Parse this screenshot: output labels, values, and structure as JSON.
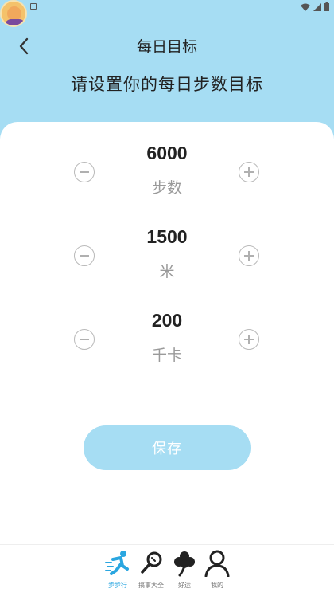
{
  "header": {
    "title": "每日目标",
    "subtitle": "请设置你的每日步数目标"
  },
  "goals": [
    {
      "value": "6000",
      "unit": "步数"
    },
    {
      "value": "1500",
      "unit": "米"
    },
    {
      "value": "200",
      "unit": "千卡"
    }
  ],
  "save_label": "保存",
  "nav": [
    {
      "label": "步步行",
      "icon": "runner-icon",
      "active": true
    },
    {
      "label": "搞事大全",
      "icon": "magnifier-icon",
      "active": false
    },
    {
      "label": "好运",
      "icon": "clover-icon",
      "active": false
    },
    {
      "label": "我的",
      "icon": "person-icon",
      "active": false
    }
  ],
  "colors": {
    "accent": "#a6ddf3",
    "nav_active": "#2aa6e0"
  }
}
